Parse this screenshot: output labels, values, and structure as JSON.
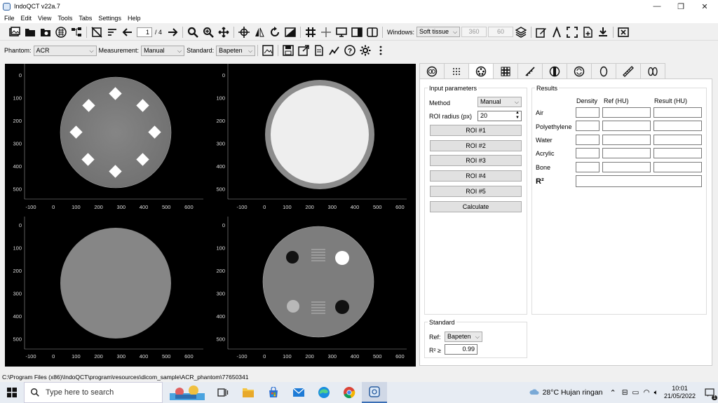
{
  "window": {
    "title": "IndoQCT v22a.7",
    "controls": {
      "minimize": "—",
      "maximize": "❐",
      "close": "✕"
    }
  },
  "menu": [
    "File",
    "Edit",
    "View",
    "Tools",
    "Tabs",
    "Settings",
    "Help"
  ],
  "toolbar": {
    "page_current": "1",
    "page_total": "/ 4",
    "windows_label": "Windows:",
    "windows_preset": "Soft tissue",
    "window_width": "360",
    "window_level": "60"
  },
  "toolbar2": {
    "phantom_label": "Phantom:",
    "phantom_value": "ACR",
    "measurement_label": "Measurement:",
    "measurement_value": "Manual",
    "standard_label": "Standard:",
    "standard_value": "Bapeten"
  },
  "viewer": {
    "y_ticks": [
      "0",
      "100",
      "200",
      "300",
      "400",
      "500"
    ],
    "x_ticks": [
      "-100",
      "0",
      "100",
      "200",
      "300",
      "400",
      "500",
      "600"
    ]
  },
  "panel": {
    "input_title": "Input parameters",
    "method_label": "Method",
    "method_value": "Manual",
    "roi_radius_label": "ROI radius (px)",
    "roi_radius_value": "20",
    "roi_buttons": [
      "ROI #1",
      "ROI #2",
      "ROI #3",
      "ROI #4",
      "ROI #5"
    ],
    "calculate_label": "Calculate",
    "results_title": "Results",
    "col_density": "Density",
    "col_ref": "Ref (HU)",
    "col_result": "Result (HU)",
    "materials": [
      "Air",
      "Polyethylene",
      "Water",
      "Acrylic",
      "Bone"
    ],
    "r2_label": "R²",
    "standard_title": "Standard",
    "ref_label": "Ref:",
    "ref_value": "Bapeten",
    "r2_ge_label": "R² ≥",
    "r2_threshold": "0.99"
  },
  "statusbar": {
    "path": "C:\\Program Files (x86)\\IndoQCT\\program\\resources\\dicom_sample\\ACR_phantom\\77650341"
  },
  "taskbar": {
    "search_placeholder": "Type here to search",
    "weather": "28°C Hujan ringan",
    "time": "10:01",
    "date": "21/05/2022",
    "notification_count": "1"
  }
}
